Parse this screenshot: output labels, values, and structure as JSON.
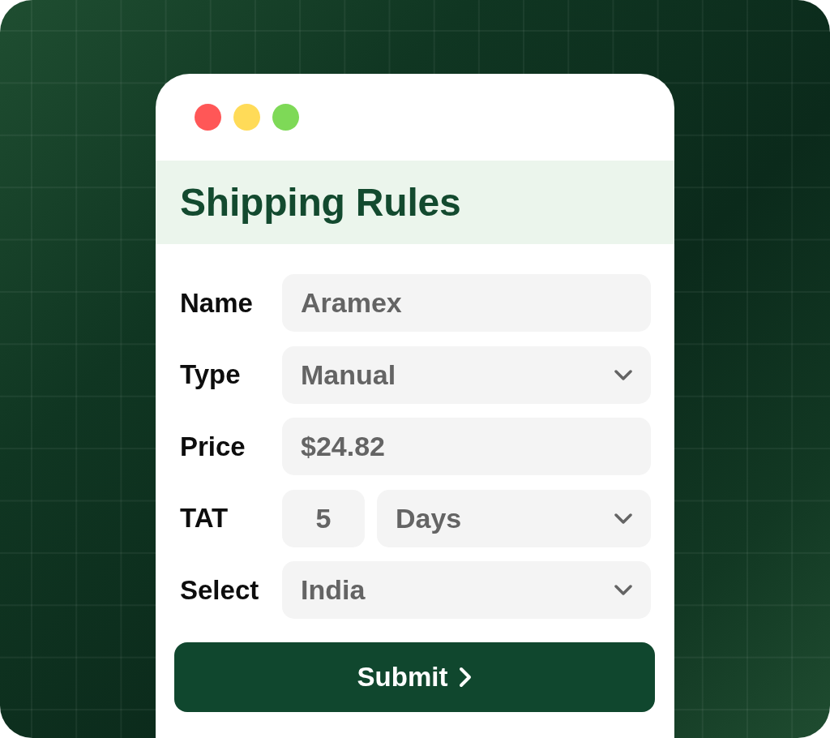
{
  "window": {
    "controls": [
      {
        "color": "#ff5757"
      },
      {
        "color": "#ffdb58"
      },
      {
        "color": "#7ed957"
      }
    ]
  },
  "title": "Shipping Rules",
  "form": {
    "fields": [
      {
        "label": "Name",
        "inputs": [
          {
            "kind": "text",
            "value": "Aramex"
          }
        ]
      },
      {
        "label": "Type",
        "inputs": [
          {
            "kind": "select",
            "value": "Manual"
          }
        ]
      },
      {
        "label": "Price",
        "inputs": [
          {
            "kind": "text",
            "value": "$24.82"
          }
        ]
      },
      {
        "label": "TAT",
        "inputs": [
          {
            "kind": "number",
            "value": "5"
          },
          {
            "kind": "select",
            "value": "Days"
          }
        ]
      },
      {
        "label": "Select",
        "inputs": [
          {
            "kind": "select",
            "value": "India"
          }
        ]
      }
    ]
  },
  "submit_button": {
    "label": "Submit"
  }
}
